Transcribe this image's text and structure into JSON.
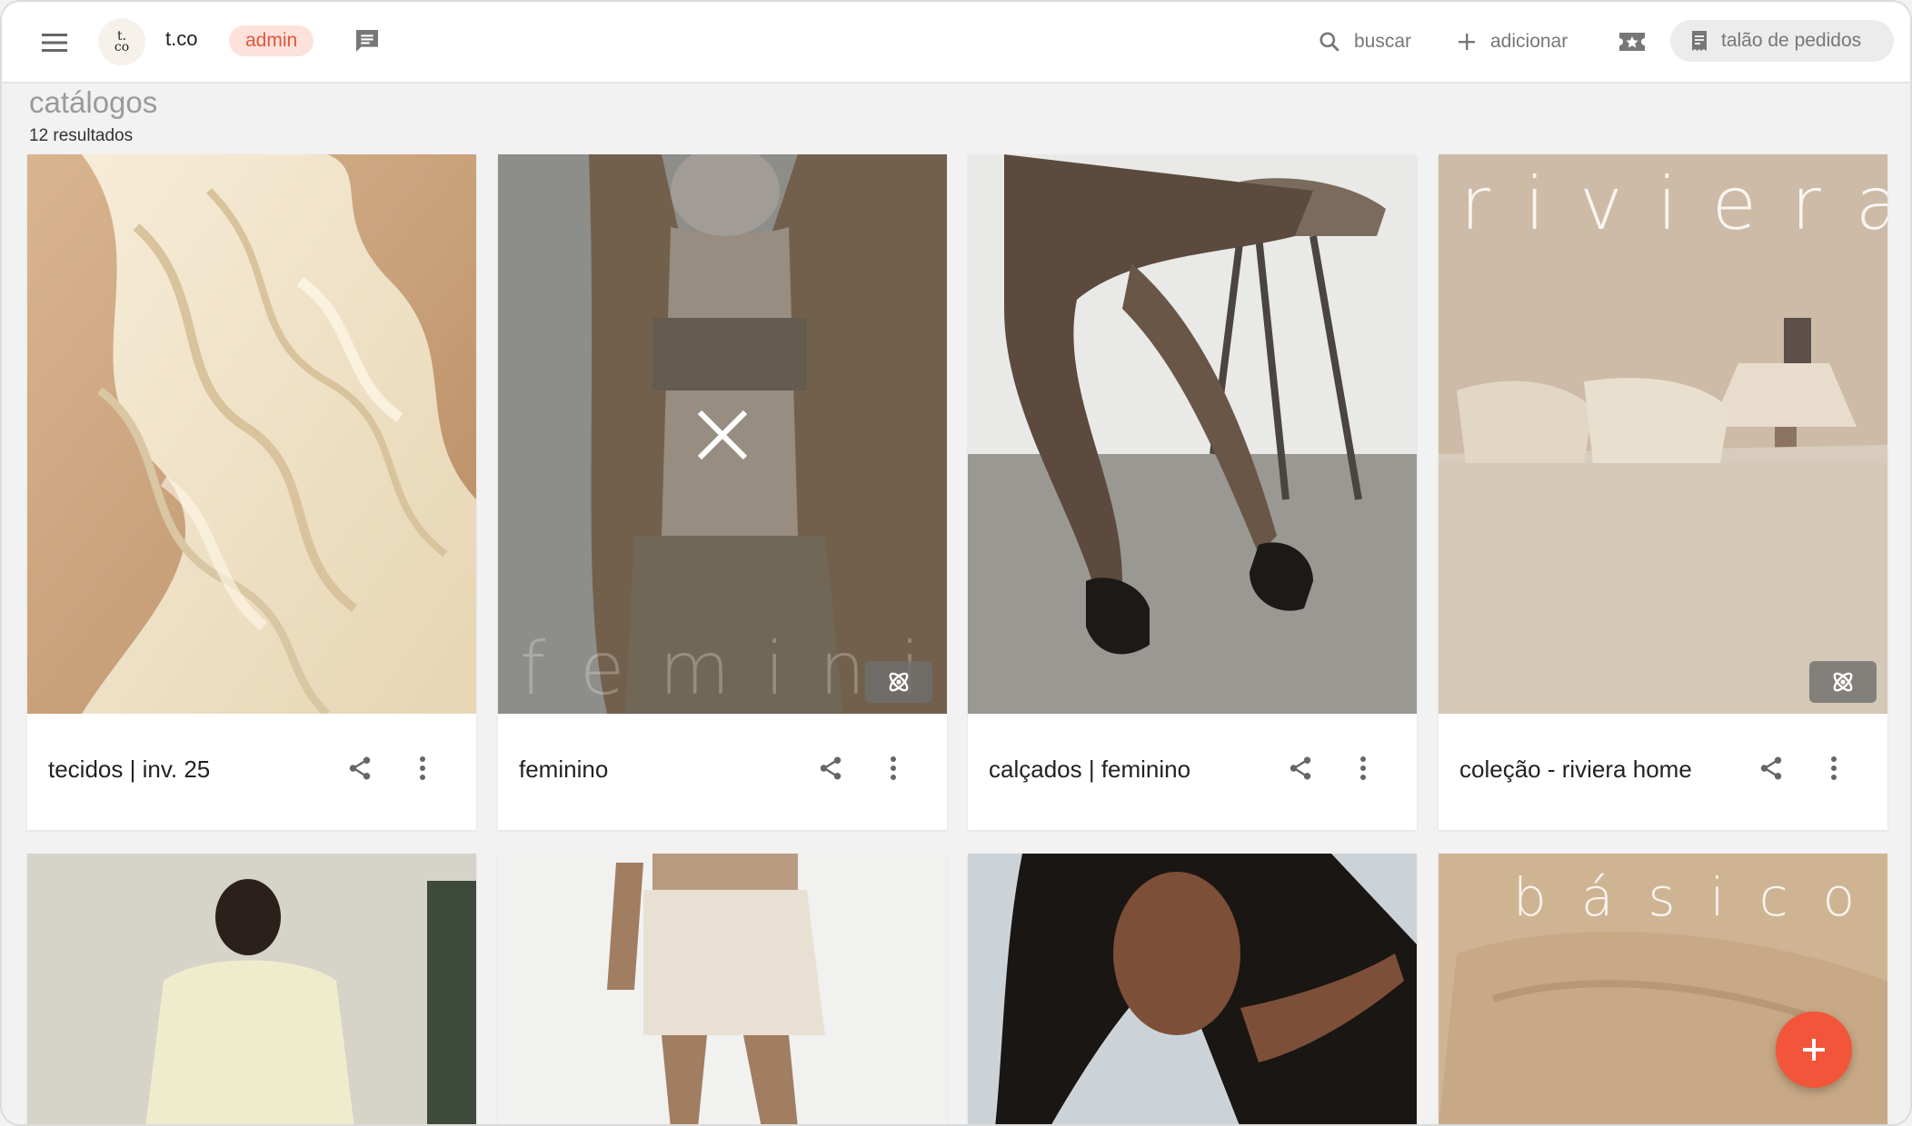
{
  "header": {
    "brand": "t.co",
    "logo_text": "t.\nco",
    "role_badge": "admin",
    "search_label": "buscar",
    "add_label": "adicionar",
    "orders_label": "talão de pedidos"
  },
  "page": {
    "title": "catálogos",
    "results": "12 resultados"
  },
  "cards": [
    {
      "label": "tecidos | inv. 25"
    },
    {
      "label": "feminino",
      "watermark": "feminino"
    },
    {
      "label": "calçados | feminino"
    },
    {
      "label": "coleção - riviera home",
      "watermark": "riviera"
    },
    {
      "label": ""
    },
    {
      "label": ""
    },
    {
      "label": ""
    },
    {
      "label": "",
      "watermark": "básicos"
    }
  ],
  "icons": {
    "menu": "menu-icon",
    "chat": "chat-icon",
    "search": "search-icon",
    "add": "plus-icon",
    "featured": "star-ticket-icon",
    "orders": "receipt-icon",
    "share": "share-icon",
    "more": "more-vert-icon",
    "close": "close-icon",
    "ai": "atom-icon",
    "fab": "plus-icon"
  },
  "colors": {
    "accent": "#f2553a",
    "badge_bg": "#fde2dc",
    "badge_text": "#e2553a"
  }
}
